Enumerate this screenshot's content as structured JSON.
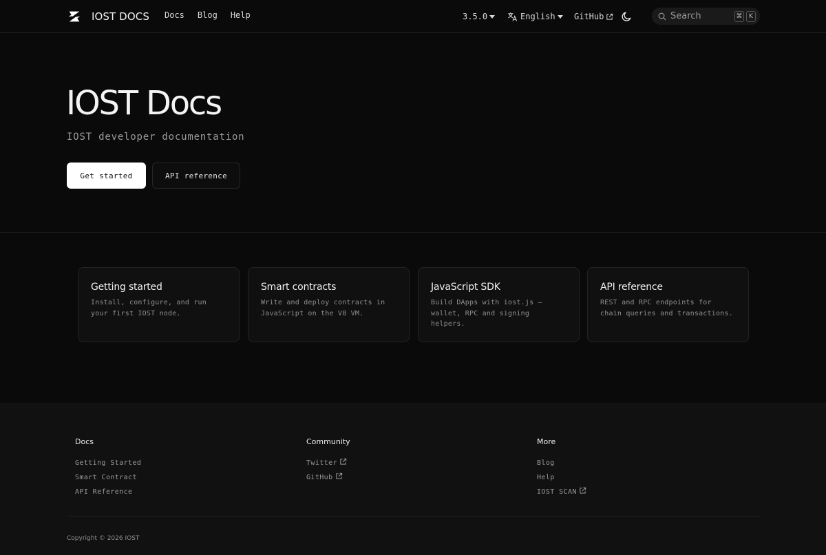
{
  "navbar": {
    "brand": "IOST DOCS",
    "links": [
      "Docs",
      "Blog",
      "Help"
    ],
    "version": "3.5.0",
    "language": "English",
    "github": "GitHub",
    "search": {
      "placeholder": "Search",
      "keys": [
        "⌘",
        "K"
      ]
    }
  },
  "hero": {
    "title": "IOST Docs",
    "tagline": "IOST developer documentation",
    "primary_button": "Get started",
    "secondary_button": "API reference"
  },
  "cards": [
    {
      "title": "Getting started",
      "description": "Install, configure, and run your first IOST node."
    },
    {
      "title": "Smart contracts",
      "description": "Write and deploy contracts in JavaScript on the V8 VM."
    },
    {
      "title": "JavaScript SDK",
      "description": "Build DApps with iost.js — wallet, RPC and signing helpers."
    },
    {
      "title": "API reference",
      "description": "REST and RPC endpoints for chain queries and transactions."
    }
  ],
  "footer": {
    "columns": [
      {
        "heading": "Docs",
        "links": [
          "Getting Started",
          "Smart Contract",
          "API Reference"
        ]
      },
      {
        "heading": "Community",
        "links": [
          "Twitter",
          "GitHub"
        ]
      },
      {
        "heading": "More",
        "links": [
          "Blog",
          "Help",
          "IOST SCAN"
        ]
      }
    ],
    "copyright": "Copyright © 2026 IOST"
  },
  "colors": {
    "background": "#0a0a0a",
    "footer_background": "#111111",
    "primary_button": "#ffffff",
    "card_background": "#101010"
  },
  "icons": {
    "logo": "iost-logo-icon",
    "language": "translate-icon",
    "external": "external-link-icon",
    "theme": "moon-icon",
    "search": "search-icon"
  }
}
